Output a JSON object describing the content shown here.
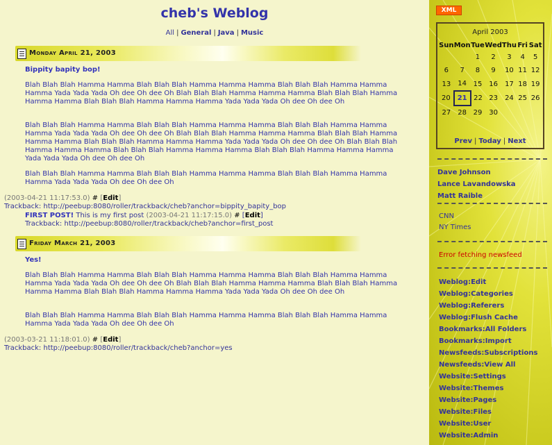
{
  "blog": {
    "title": "cheb's Weblog",
    "categories": [
      "All",
      "General",
      "Java",
      "Music"
    ]
  },
  "days": [
    {
      "date": "Monday April 21, 2003",
      "entry_title": "Bippity bapity bop!",
      "paragraphs": [
        "Blah Blah Blah Hamma Hamma Blah Blah Blah Hamma Hamma Hamma Blah Blah Blah Hamma Hamma Hamma Yada Yada Yada Oh dee Oh dee Oh Blah Blah Blah Hamma Hamma Hamma Blah Blah Blah Hamma Hamma Hamma Blah Blah Blah Hamma Hamma Hamma Yada Yada Yada Oh dee Oh dee Oh",
        "Blah Blah Blah Hamma Hamma Blah Blah Blah Hamma Hamma Hamma Blah Blah Blah Hamma Hamma Hamma Yada Yada Yada Oh dee Oh dee Oh Blah Blah Blah Hamma Hamma Hamma Blah Blah Blah Hamma Hamma Hamma Blah Blah Blah Hamma Hamma Hamma Yada Yada Yada Oh dee Oh dee Oh Blah Blah Blah Hamma Hamma Hamma Blah Blah Blah Hamma Hamma Hamma Blah Blah Blah Hamma Hamma Hamma Yada Yada Yada Oh dee Oh dee Oh",
        "Blah Blah Blah Hamma Hamma Blah Blah Blah Hamma Hamma Hamma Blah Blah Blah Hamma Hamma Hamma Yada Yada Yada Oh dee Oh dee Oh"
      ],
      "timestamp": "(2003-04-21 11:17:53.0)",
      "hash": "#",
      "edit_label": "Edit",
      "trackback": "Trackback: http://peebup:8080/roller/trackback/cheb?anchor=bippity_bapity_bop",
      "comment": {
        "title": "FIRST POST!",
        "text": "This is my first post",
        "timestamp": "(2003-04-21 11:17:15.0)",
        "hash": "#",
        "edit_label": "Edit",
        "trackback": "Trackback: http://peebup:8080/roller/trackback/cheb?anchor=first_post"
      }
    },
    {
      "date": "Friday March 21, 2003",
      "entry_title": "Yes!",
      "paragraphs": [
        "Blah Blah Blah Hamma Hamma Blah Blah Blah Hamma Hamma Hamma Blah Blah Blah Hamma Hamma Hamma Yada Yada Yada Oh dee Oh dee Oh Blah Blah Blah Hamma Hamma Hamma Blah Blah Blah Hamma Hamma Hamma Blah Blah Blah Hamma Hamma Hamma Yada Yada Yada Oh dee Oh dee Oh",
        "Blah Blah Blah Hamma Hamma Blah Blah Blah Hamma Hamma Hamma Blah Blah Blah Hamma Hamma Hamma Yada Yada Yada Oh dee Oh dee Oh"
      ],
      "timestamp": "(2003-03-21 11:18:01.0)",
      "hash": "#",
      "edit_label": "Edit",
      "trackback": "Trackback: http://peebup:8080/roller/trackback/cheb?anchor=yes"
    }
  ],
  "sidebar": {
    "xml_badge": "XML",
    "calendar": {
      "month": "April 2003",
      "weekdays": [
        "Sun",
        "Mon",
        "Tue",
        "Wed",
        "Thu",
        "Fri",
        "Sat"
      ],
      "weeks": [
        [
          "",
          "",
          "1",
          "2",
          "3",
          "4",
          "5"
        ],
        [
          "6",
          "7",
          "8",
          "9",
          "10",
          "11",
          "12"
        ],
        [
          "13",
          "14",
          "15",
          "16",
          "17",
          "18",
          "19"
        ],
        [
          "20",
          "21",
          "22",
          "23",
          "24",
          "25",
          "26"
        ],
        [
          "27",
          "28",
          "29",
          "30",
          "",
          "",
          ""
        ]
      ],
      "selected_day": "21",
      "nav": [
        "Prev",
        "Today",
        "Next"
      ]
    },
    "blogroll": [
      "Dave Johnson",
      "Lance Lavandowska",
      "Matt Raible"
    ],
    "news": [
      "CNN",
      "NY Times"
    ],
    "newsfeed_error": "Error fetching newsfeed",
    "admin_links": [
      "Weblog:Edit",
      "Weblog:Categories",
      "Weblog:Referers",
      "Weblog:Flush Cache",
      "Bookmarks:All Folders",
      "Bookmarks:Import",
      "Newsfeeds:Subscriptions",
      "Newsfeeds:View All",
      "Website:Settings",
      "Website:Themes",
      "Website:Pages",
      "Website:Files",
      "Website:User",
      "Website:Admin"
    ]
  }
}
